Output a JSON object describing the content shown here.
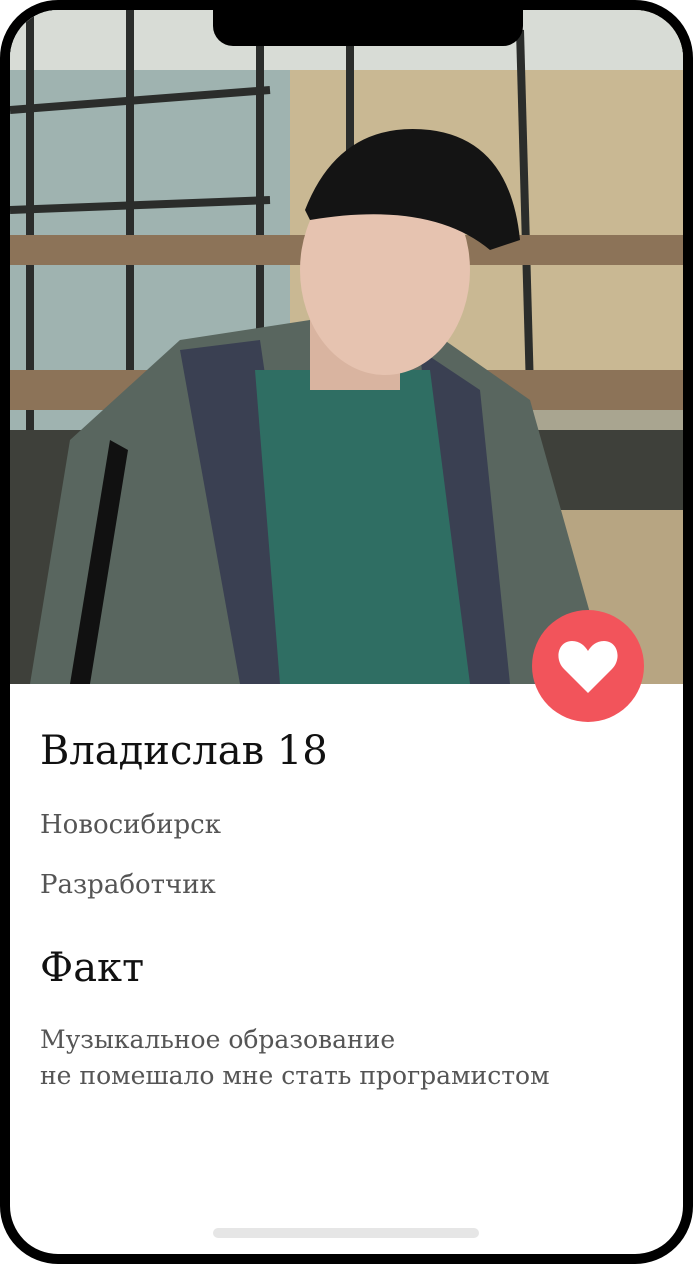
{
  "profile": {
    "name_age": "Владислав 18",
    "city": "Новосибирск",
    "occupation": "Разработчик"
  },
  "fact": {
    "title": "Факт",
    "lines": [
      "Музыкальное образование",
      "не помешало мне стать програмистом"
    ]
  },
  "colors": {
    "accent": "#f2545b",
    "text_primary": "#111111",
    "text_secondary": "#555555"
  },
  "icons": {
    "like": "heart-icon"
  }
}
